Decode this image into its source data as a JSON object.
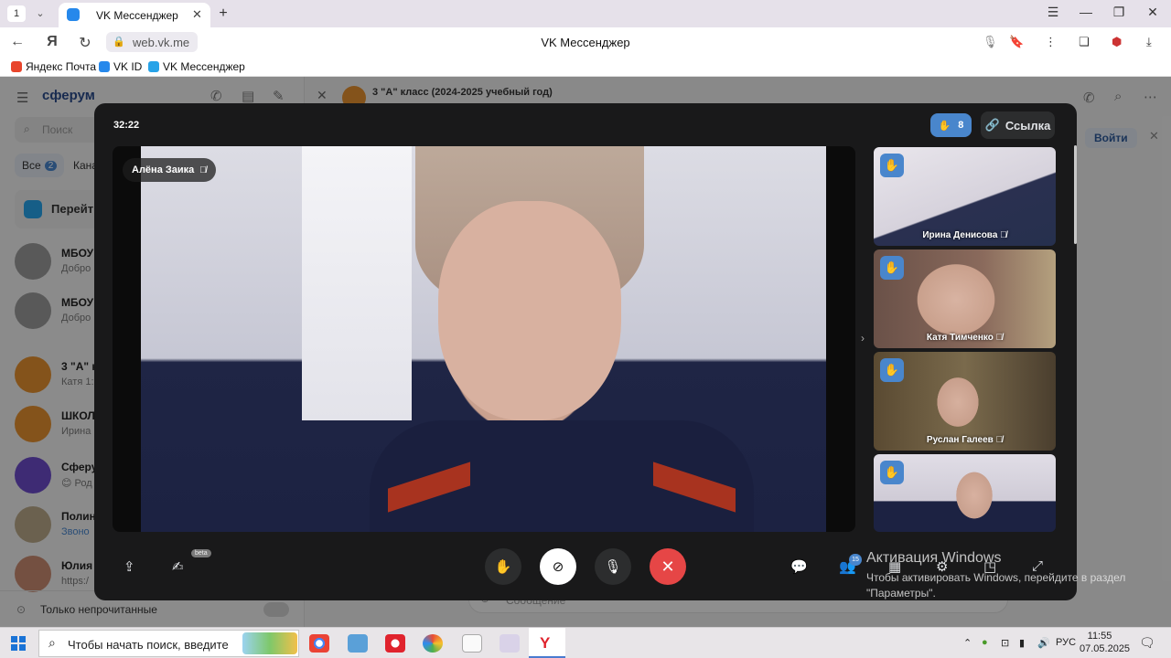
{
  "browser": {
    "tab_count": "1",
    "tab_title": "VK Мессенджер",
    "url": "web.vk.me",
    "page_title": "VK Мессенджер",
    "bookmarks": [
      "Яндекс Почта",
      "VK ID",
      "VK Мессенджер"
    ]
  },
  "vk_background": {
    "logo": "сферум",
    "search_placeholder": "Поиск",
    "filter_all": "Все",
    "filter_all_count": "2",
    "filter_second": "Кана",
    "goto_label": "Перейт",
    "chat_header_title": "3 \"А\" класс (2024-2025 учебный год)",
    "login_button": "Войти",
    "only_unread": "Только непрочитанные",
    "message_placeholder": "Сообщение",
    "chats": [
      {
        "name": "МБОУ",
        "preview": "Добро"
      },
      {
        "name": "МБОУ",
        "preview": "Добро"
      },
      {
        "name": "3 \"А\" к",
        "preview": "Катя 1:"
      },
      {
        "name": "ШКОЛ",
        "preview": "Ирина"
      },
      {
        "name": "Сферу",
        "preview": "😊 Род"
      },
      {
        "name": "Полин",
        "preview": "Звоно"
      },
      {
        "name": "Юлия",
        "preview": "https:/"
      }
    ]
  },
  "call": {
    "timer": "32:22",
    "raised_hands": "8",
    "link_label": "Ссылка",
    "main_speaker": "Алёна Заика",
    "participants": [
      {
        "name": "Ирина Денисова"
      },
      {
        "name": "Катя Тимченко"
      },
      {
        "name": "Руслан Галеев"
      },
      {
        "name": ""
      }
    ],
    "beta_badge": "beta",
    "participants_count": "15",
    "colors": {
      "accent": "#4986cc",
      "end_call": "#e64646",
      "modal_bg": "#19191a"
    }
  },
  "watermark": {
    "title": "Активация Windows",
    "text": "Чтобы активировать Windows, перейдите в раздел \"Параметры\"."
  },
  "taskbar": {
    "search_text": "Чтобы начать поиск, введите",
    "language": "РУС",
    "time": "11:55",
    "date": "07.05.2025"
  }
}
